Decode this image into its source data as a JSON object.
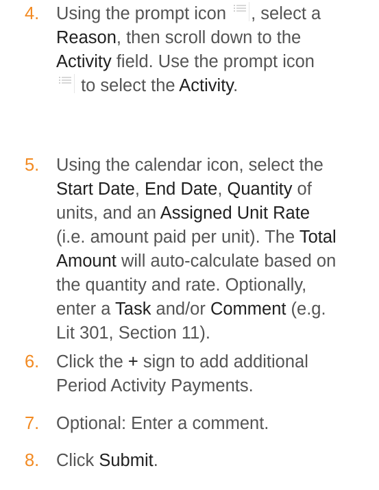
{
  "steps": [
    {
      "number": "4.",
      "lines": [
        [
          {
            "t": "Using the prompt icon "
          },
          {
            "icon": "prompt-icon"
          },
          {
            "t": ", select a"
          }
        ],
        [
          {
            "t": "Reason",
            "b": true
          },
          {
            "t": ", then scroll down to the"
          }
        ],
        [
          {
            "t": "Activity",
            "b": true
          },
          {
            "t": " field. Use the prompt icon"
          }
        ],
        [
          {
            "icon": "prompt-icon"
          },
          {
            "t": " to select the "
          },
          {
            "t": "Activity",
            "b": true
          },
          {
            "t": "."
          }
        ]
      ]
    },
    {
      "number": "5.",
      "lines": [
        [
          {
            "t": "Using the calendar icon, select the"
          }
        ],
        [
          {
            "t": "Start Date",
            "b": true
          },
          {
            "t": ", "
          },
          {
            "t": "End Date",
            "b": true
          },
          {
            "t": ", "
          },
          {
            "t": "Quantity",
            "b": true
          },
          {
            "t": " of"
          }
        ],
        [
          {
            "t": "units, and an "
          },
          {
            "t": "Assigned Unit Rate",
            "b": true
          }
        ],
        [
          {
            "t": "(i.e. amount paid per unit). The "
          },
          {
            "t": "Total",
            "b": true
          }
        ],
        [
          {
            "t": "Amount",
            "b": true
          },
          {
            "t": " will auto-calculate based on"
          }
        ],
        [
          {
            "t": "the quantity and rate. Optionally,"
          }
        ],
        [
          {
            "t": "enter a "
          },
          {
            "t": "Task",
            "b": true
          },
          {
            "t": " and/or "
          },
          {
            "t": "Comment",
            "b": true
          },
          {
            "t": " (e.g."
          }
        ],
        [
          {
            "t": "Lit 301, Section 11)."
          }
        ]
      ]
    },
    {
      "number": "6.",
      "lines": [
        [
          {
            "t": "Click the "
          },
          {
            "t": "+",
            "b": true
          },
          {
            "t": " sign to add additional"
          }
        ],
        [
          {
            "t": "Period Activity Payments."
          }
        ]
      ]
    },
    {
      "number": "7.",
      "lines": [
        [
          {
            "t": "Optional: Enter a comment."
          }
        ]
      ]
    },
    {
      "number": "8.",
      "lines": [
        [
          {
            "t": "Click "
          },
          {
            "t": "Submit",
            "b": true
          },
          {
            "t": "."
          }
        ]
      ]
    }
  ]
}
